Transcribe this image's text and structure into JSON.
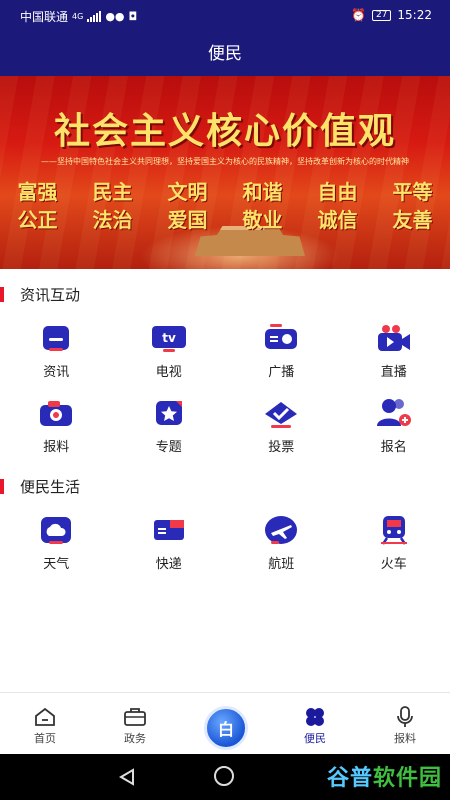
{
  "status_bar": {
    "carrier": "中国联通",
    "network": "4G",
    "battery": "27",
    "time": "15:22"
  },
  "title": "便民",
  "banner": {
    "title": "社会主义核心价值观",
    "subtitle": "——坚持中国特色社会主义共同理想，坚持爱国主义为核心的民族精神，坚持改革创新为核心的时代精神",
    "row1": [
      "富强",
      "民主",
      "文明",
      "和谐",
      "自由",
      "平等"
    ],
    "row2": [
      "公正",
      "法治",
      "爱国",
      "敬业",
      "诚信",
      "友善"
    ]
  },
  "sections": [
    {
      "title": "资讯互动",
      "items": [
        {
          "label": "资讯",
          "icon": "news-icon"
        },
        {
          "label": "电视",
          "icon": "tv-icon"
        },
        {
          "label": "广播",
          "icon": "radio-icon"
        },
        {
          "label": "直播",
          "icon": "live-video-icon"
        },
        {
          "label": "报料",
          "icon": "camera-icon"
        },
        {
          "label": "专题",
          "icon": "star-topic-icon"
        },
        {
          "label": "投票",
          "icon": "vote-check-icon"
        },
        {
          "label": "报名",
          "icon": "user-add-icon"
        }
      ]
    },
    {
      "title": "便民生活",
      "items": [
        {
          "label": "天气",
          "icon": "cloud-icon"
        },
        {
          "label": "快递",
          "icon": "delivery-truck-icon"
        },
        {
          "label": "航班",
          "icon": "airplane-icon"
        },
        {
          "label": "火车",
          "icon": "train-icon"
        }
      ]
    }
  ],
  "bottom_nav": [
    {
      "label": "首页",
      "icon": "home-icon"
    },
    {
      "label": "政务",
      "icon": "briefcase-icon"
    },
    {
      "label": "便民",
      "icon": "clover-icon",
      "active": true
    },
    {
      "label": "报料",
      "icon": "microphone-icon"
    }
  ],
  "center_button_glyph": "白",
  "watermark": {
    "a": "谷普",
    "b": "软件园"
  },
  "colors": {
    "header": "#1b1a7a",
    "accent_red": "#e8172b",
    "icon_blue": "#2a2ab8",
    "icon_red": "#f03a4a",
    "active_nav": "#1b1a9c"
  }
}
